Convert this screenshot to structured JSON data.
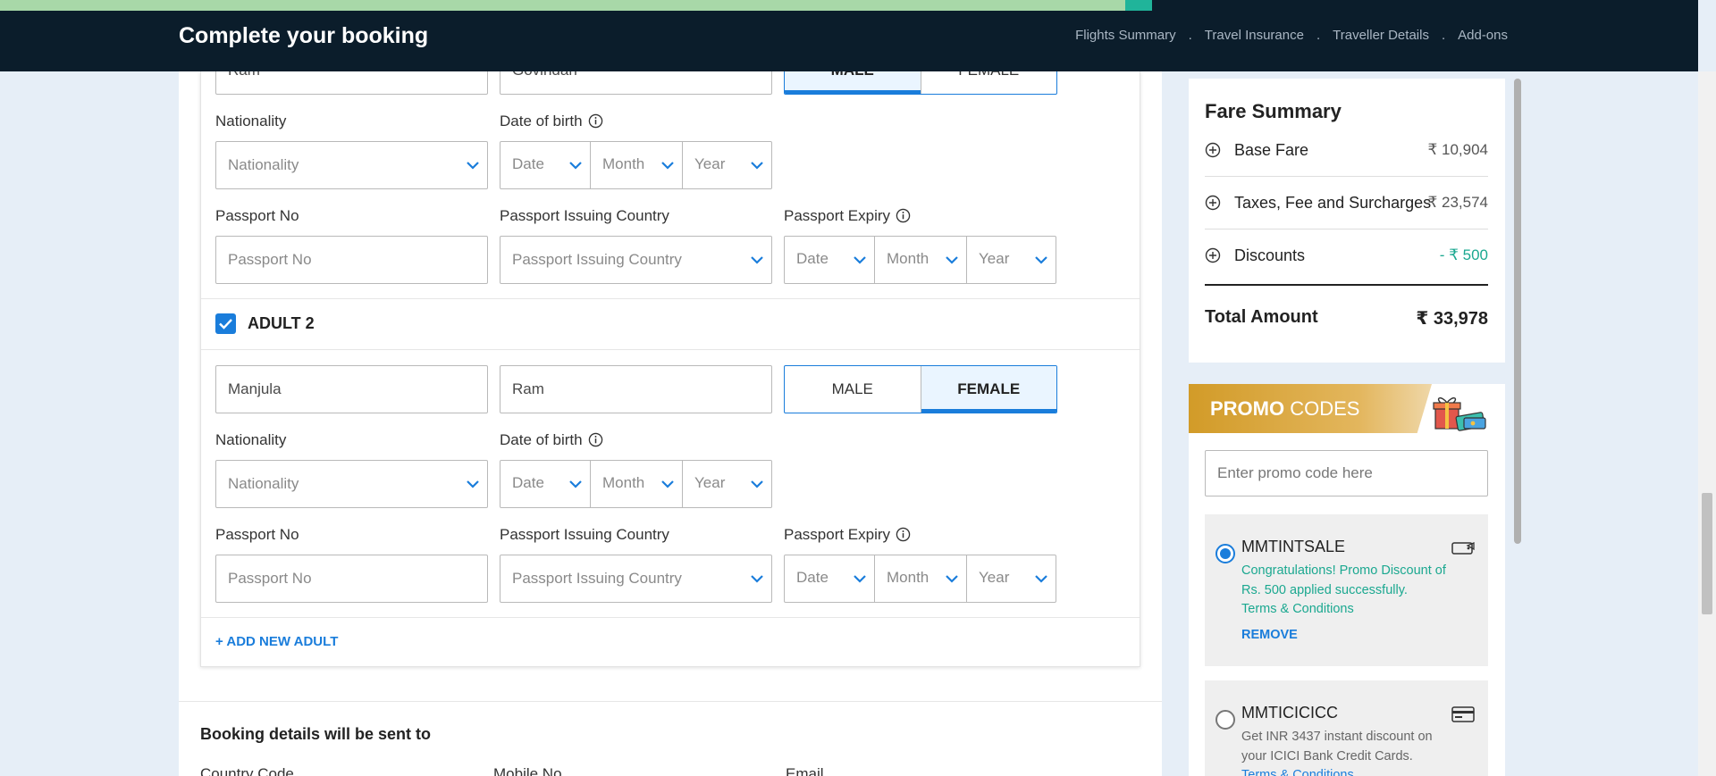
{
  "header": {
    "title": "Complete your booking",
    "progress": 0.975,
    "nav": [
      "Flights Summary",
      "Travel Insurance",
      "Traveller Details",
      "Add-ons"
    ],
    "nav_separator": "."
  },
  "adult1": {
    "first_name": "Ram",
    "last_name": "Govindan",
    "gender_male": "MALE",
    "gender_female": "FEMALE",
    "selected_gender": "MALE",
    "nationality_label": "Nationality",
    "nationality_placeholder": "Nationality",
    "dob_label": "Date of birth",
    "date_ph": "Date",
    "month_ph": "Month",
    "year_ph": "Year",
    "passport_no_label": "Passport No",
    "passport_no_placeholder": "Passport No",
    "passport_country_label": "Passport Issuing Country",
    "passport_country_placeholder": "Passport Issuing Country",
    "passport_expiry_label": "Passport Expiry"
  },
  "adult2": {
    "title": "ADULT 2",
    "checked": true,
    "first_name": "Manjula",
    "last_name": "Ram",
    "gender_male": "MALE",
    "gender_female": "FEMALE",
    "selected_gender": "FEMALE",
    "nationality_label": "Nationality",
    "nationality_placeholder": "Nationality",
    "dob_label": "Date of birth",
    "date_ph": "Date",
    "month_ph": "Month",
    "year_ph": "Year",
    "passport_no_label": "Passport No",
    "passport_no_placeholder": "Passport No",
    "passport_country_label": "Passport Issuing Country",
    "passport_country_placeholder": "Passport Issuing Country",
    "passport_expiry_label": "Passport Expiry"
  },
  "add_adult": "+ ADD NEW ADULT",
  "booking_details": {
    "title": "Booking details will be sent to",
    "country_code_label": "Country Code",
    "mobile_label": "Mobile No",
    "email_label": "Email"
  },
  "fare_summary": {
    "title": "Fare Summary",
    "rows": [
      {
        "label": "Base Fare",
        "value": "₹ 10,904"
      },
      {
        "label": "Taxes, Fee and Surcharges",
        "value": "₹ 23,574"
      },
      {
        "label": "Discounts",
        "value": "- ₹ 500"
      }
    ],
    "total_label": "Total Amount",
    "total_value": "₹ 33,978",
    "discount_color": "#1ba890"
  },
  "promo": {
    "banner_bold": "PROMO",
    "banner_rest": " CODES",
    "input_placeholder": "Enter promo code here",
    "coupons": [
      {
        "code": "MMTINTSALE",
        "selected": true,
        "desc": "Congratulations! Promo Discount of Rs. 500 applied successfully.",
        "link": "Terms & Conditions",
        "remove": "REMOVE",
        "icon": "tag-icon"
      },
      {
        "code": "MMTICICICC",
        "selected": false,
        "desc": "Get INR 3437 instant discount on your ICICI Bank Credit Cards.",
        "link": "Terms & Conditions",
        "icon": "credit-card-icon"
      }
    ]
  },
  "colors": {
    "header_bg": "#0b1d2b",
    "accent": "#1a7ddb",
    "success": "#1ba890",
    "page_bg": "#e6eef7"
  }
}
